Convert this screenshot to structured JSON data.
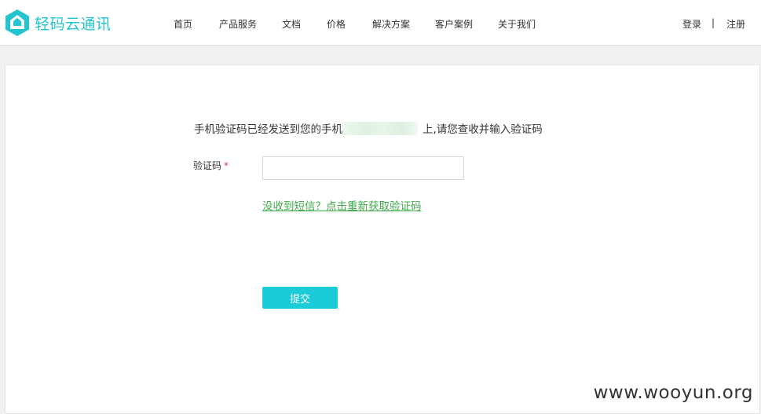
{
  "brand": {
    "name": "轻码云通讯",
    "color": "#22c4cf"
  },
  "nav": {
    "items": [
      "首页",
      "产品服务",
      "文档",
      "价格",
      "解决方案",
      "客户案例",
      "关于我们"
    ]
  },
  "auth": {
    "login": "登录",
    "separator": "|",
    "register": "注册"
  },
  "verify": {
    "notice_prefix": "手机验证码已经发送到您的手机",
    "notice_suffix": "上,请您查收并输入验证码",
    "code_label": "验证码",
    "required_mark": "*",
    "code_value": "",
    "resend_link": "没收到短信？点击重新获取验证码",
    "submit_label": "提交"
  },
  "colors": {
    "accent": "#1ccbd8",
    "link": "#3dab47",
    "required": "#e23a3a"
  },
  "watermark": "www.wooyun.org"
}
